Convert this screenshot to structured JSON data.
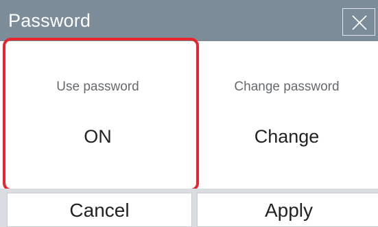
{
  "dialog": {
    "title": "Password",
    "close_icon": "close-icon"
  },
  "options": {
    "use_password": {
      "label": "Use password",
      "value": "ON"
    },
    "change_password": {
      "label": "Change password",
      "value": "Change"
    }
  },
  "footer": {
    "cancel_label": "Cancel",
    "apply_label": "Apply"
  },
  "colors": {
    "title_bar": "#7d8c99",
    "highlight": "#e8242c",
    "footer_bg": "#d9dde2"
  }
}
